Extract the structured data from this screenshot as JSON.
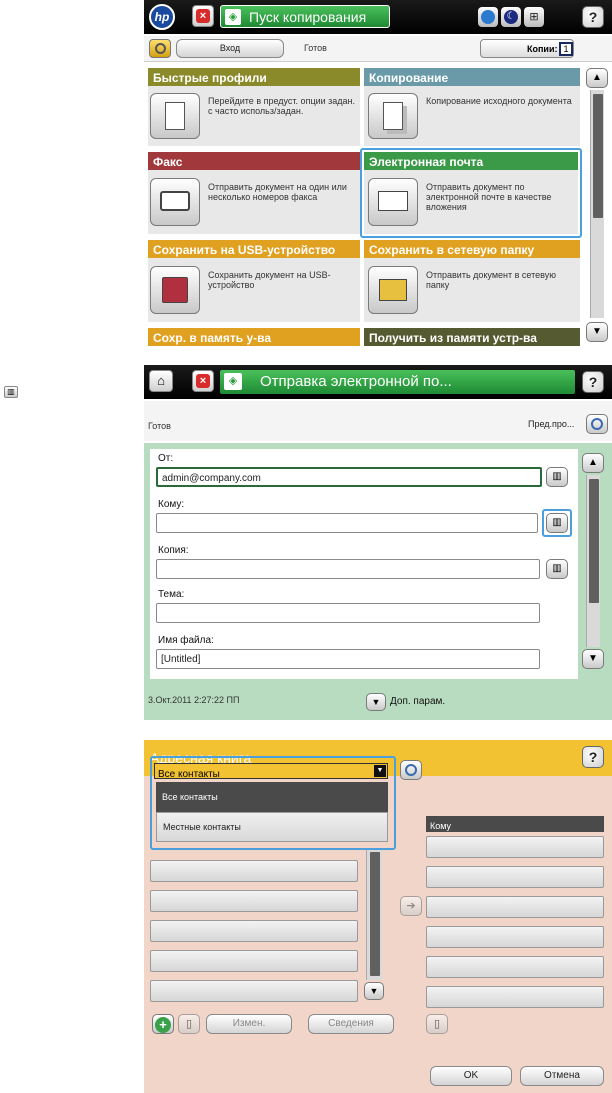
{
  "panel1": {
    "start_copy": "Пуск копирования",
    "sign_in": "Вход",
    "status": "Готов",
    "copies_label": "Копии:",
    "copies_value": "1",
    "tiles": [
      {
        "title": "Быстрые профили",
        "desc": "Перейдите в предуст. опции задан. с часто использ/задан.",
        "color": "#8a8a2a"
      },
      {
        "title": "Копирование",
        "desc": "Копирование исходного документа",
        "color": "#6a9aa8"
      },
      {
        "title": "Факс",
        "desc": "Отправить документ на один или несколько номеров факса",
        "color": "#a0383c"
      },
      {
        "title": "Электронная почта",
        "desc": "Отправить документ по электронной почте в качестве вложения",
        "color": "#3a9a48"
      },
      {
        "title": "Сохранить на USB-устройство",
        "desc": "Сохранить документ на USB-устройство",
        "color": "#e0a020"
      },
      {
        "title": "Сохранить в сетевую папку",
        "desc": "Отправить документ в сетевую папку",
        "color": "#e0a020"
      },
      {
        "title": "Сохр. в память у-ва",
        "color": "#e0a020"
      },
      {
        "title": "Получить из памяти устр-ва",
        "color": "#565a30"
      }
    ]
  },
  "panel2": {
    "title": "Отправка электронной по...",
    "status": "Готов",
    "preview": "Пред.про...",
    "from_label": "От:",
    "from_value": "admin@company.com",
    "to_label": "Кому:",
    "cc_label": "Копия:",
    "subject_label": "Тема:",
    "filename_label": "Имя файла:",
    "filename_value": "[Untitled]",
    "datetime": "3.Окт.2011 2:27:22 ПП",
    "more_options": "Доп. парам."
  },
  "panel3": {
    "title": "Адресная книга",
    "dropdown_value": "Все контакты",
    "options": [
      "Все контакты",
      "Местные контакты"
    ],
    "to_header": "Кому",
    "edit_label": "Измен.",
    "details_label": "Сведения",
    "ok_label": "OK",
    "cancel_label": "Отмена"
  },
  "colors": {
    "hp_blue": "#1a4aa0",
    "green_header": "#2f9a45",
    "selection_blue": "#4a9fdc",
    "panel2_bg": "#b8dcc0",
    "panel3_bg": "#f0d5c8",
    "panel3_header": "#f2c232"
  }
}
